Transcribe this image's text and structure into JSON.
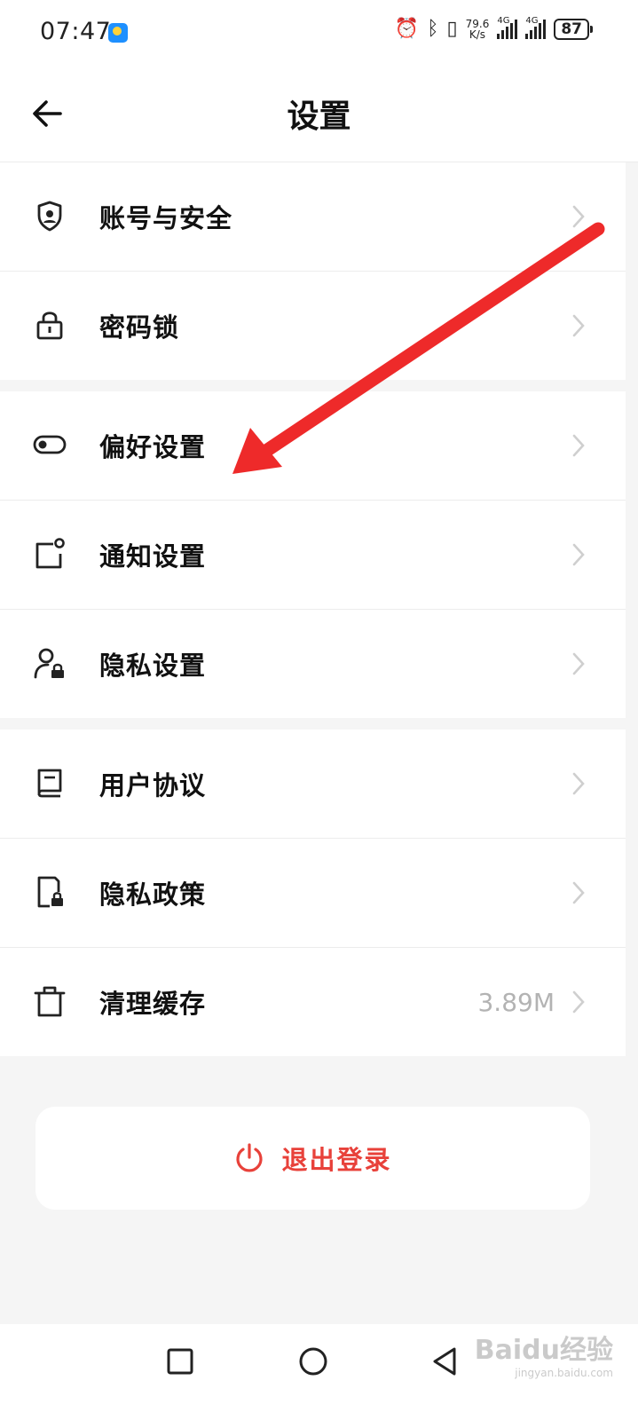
{
  "status_bar": {
    "time": "07:47",
    "speed_value": "79.6",
    "speed_unit": "K/s",
    "network_1": "4G",
    "network_2": "4G",
    "battery": "87"
  },
  "header": {
    "title": "设置",
    "back_icon": "arrow-left-icon"
  },
  "groups": [
    {
      "items": [
        {
          "label": "账号与安全",
          "icon": "shield-user-icon"
        },
        {
          "label": "密码锁",
          "icon": "lock-icon"
        }
      ]
    },
    {
      "items": [
        {
          "label": "偏好设置",
          "icon": "toggle-icon"
        },
        {
          "label": "通知设置",
          "icon": "notification-icon"
        },
        {
          "label": "隐私设置",
          "icon": "user-lock-icon"
        }
      ]
    },
    {
      "items": [
        {
          "label": "用户协议",
          "icon": "book-icon"
        },
        {
          "label": "隐私政策",
          "icon": "document-lock-icon"
        },
        {
          "label": "清理缓存",
          "icon": "trash-icon",
          "value": "3.89M"
        }
      ]
    }
  ],
  "logout": {
    "label": "退出登录",
    "icon": "power-icon",
    "color": "#e8413a"
  },
  "annotation": {
    "arrow_color": "#ee2a2a"
  },
  "watermark": {
    "text": "Baidu经验",
    "sub": "jingyan.baidu.com"
  },
  "colors": {
    "accent": "#e8413a",
    "background": "#f5f5f5",
    "muted_text": "#b3b3b3"
  }
}
